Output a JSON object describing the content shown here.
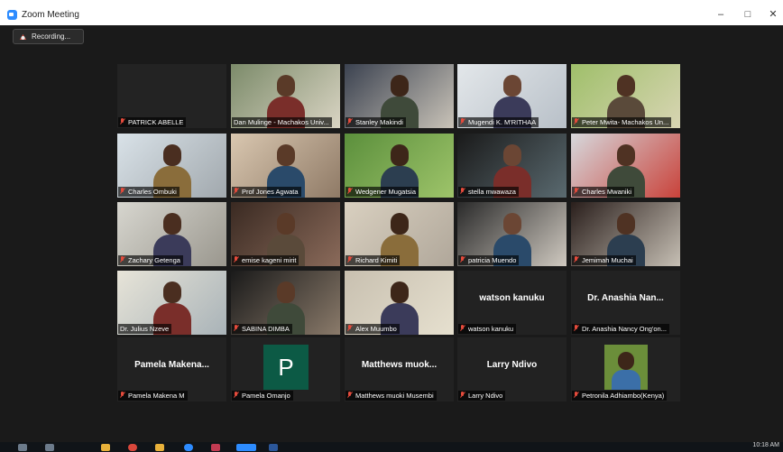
{
  "window": {
    "title": "Zoom Meeting",
    "min_label": "–",
    "max_label": "□",
    "close_label": "✕",
    "accent_color": "#2d8cff"
  },
  "recording": {
    "label": "Recording...",
    "icon": "record-icon"
  },
  "participants": [
    {
      "name": "PATRICK ABELLE",
      "muted": true,
      "video": "dark"
    },
    {
      "name": "Dan Mulinge - Machakos Univ...",
      "muted": false,
      "video": "on",
      "active_speaker": true
    },
    {
      "name": "Stanley Makindi",
      "muted": true,
      "video": "on"
    },
    {
      "name": "Mugendi K. M'RITHAA",
      "muted": true,
      "video": "on"
    },
    {
      "name": "Peter Mwita- Machakos Un...",
      "muted": true,
      "video": "on"
    },
    {
      "name": "Charles Ombuki",
      "muted": true,
      "video": "on"
    },
    {
      "name": "Prof Jones Agwata",
      "muted": true,
      "video": "on"
    },
    {
      "name": "Wedgener Mugatsia",
      "muted": true,
      "video": "on"
    },
    {
      "name": "stella mwawaza",
      "muted": true,
      "video": "on"
    },
    {
      "name": "Charles Mwaniki",
      "muted": true,
      "video": "on"
    },
    {
      "name": "Zachary Getenga",
      "muted": true,
      "video": "on"
    },
    {
      "name": "emise kageni mirit",
      "muted": true,
      "video": "on"
    },
    {
      "name": "Richard Kimiti",
      "muted": true,
      "video": "on"
    },
    {
      "name": "patricia Muendo",
      "muted": true,
      "video": "on"
    },
    {
      "name": "Jemimah Muchai",
      "muted": true,
      "video": "on"
    },
    {
      "name": "Dr. Julius Nzeve",
      "muted": false,
      "video": "on"
    },
    {
      "name": "SABINA DIMBA",
      "muted": true,
      "video": "on"
    },
    {
      "name": "Alex Muumbo",
      "muted": true,
      "video": "on"
    },
    {
      "name": "watson kanuku",
      "muted": true,
      "video": "off",
      "display": "watson kanuku"
    },
    {
      "name": "Dr. Anashia Nancy Ong'on...",
      "muted": true,
      "video": "off",
      "display": "Dr. Anashia Nan..."
    },
    {
      "name": "Pamela Makena M",
      "muted": true,
      "video": "off",
      "display": "Pamela Makena..."
    },
    {
      "name": "Pamela Omanjo",
      "muted": true,
      "video": "avatar",
      "avatar_letter": "P"
    },
    {
      "name": "Matthews muoki Musembi",
      "muted": true,
      "video": "off",
      "display": "Matthews muok..."
    },
    {
      "name": "Larry Ndivo",
      "muted": true,
      "video": "off",
      "display": "Larry Ndivo"
    },
    {
      "name": "Petronila Adhiambo(Kenya)",
      "muted": true,
      "video": "photo"
    }
  ],
  "taskbar": {
    "clock": "10:18 AM"
  }
}
